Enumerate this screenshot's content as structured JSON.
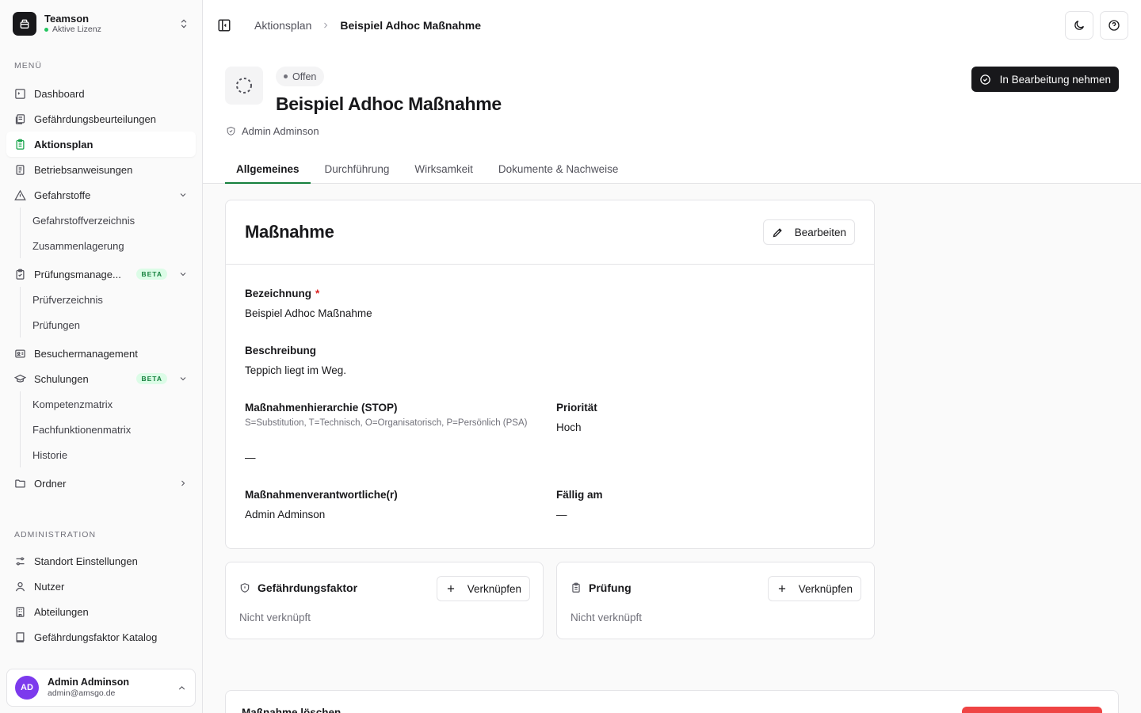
{
  "team": {
    "name": "Teamson",
    "status": "Aktive Lizenz"
  },
  "sidebar": {
    "menu_label": "MENÜ",
    "items": {
      "dashboard": "Dashboard",
      "gefaehrdungsbeurteilungen": "Gefährdungsbeurteilungen",
      "aktionsplan": "Aktionsplan",
      "betriebsanweisungen": "Betriebsanweisungen",
      "gefahrstoffe": "Gefahrstoffe",
      "gefahrstoffverzeichnis": "Gefahrstoffverzeichnis",
      "zusammenlagerung": "Zusammenlagerung",
      "pruefungsmanagement": "Prüfungsmanage...",
      "pruefungsmanagement_badge": "BETA",
      "pruefverzeichnis": "Prüfverzeichnis",
      "pruefungen": "Prüfungen",
      "besuchermanagement": "Besuchermanagement",
      "schulungen": "Schulungen",
      "schulungen_badge": "BETA",
      "kompetenzmatrix": "Kompetenzmatrix",
      "fachfunktionenmatrix": "Fachfunktionenmatrix",
      "historie": "Historie",
      "ordner": "Ordner"
    },
    "admin_label": "ADMINISTRATION",
    "admin_items": {
      "standort": "Standort Einstellungen",
      "nutzer": "Nutzer",
      "abteilungen": "Abteilungen",
      "katalog": "Gefährdungsfaktor Katalog"
    }
  },
  "user": {
    "initials": "AD",
    "name": "Admin Adminson",
    "email": "admin@amsgo.de"
  },
  "breadcrumb": {
    "parent": "Aktionsplan",
    "current": "Beispiel Adhoc Maßnahme"
  },
  "header": {
    "status": "Offen",
    "title": "Beispiel Adhoc Maßnahme",
    "owner": "Admin Adminson",
    "primary_action": "In Bearbeitung nehmen"
  },
  "tabs": [
    "Allgemeines",
    "Durchführung",
    "Wirksamkeit",
    "Dokumente & Nachweise"
  ],
  "measure": {
    "title": "Maßnahme",
    "edit_label": "Bearbeiten",
    "bezeichnung_label": "Bezeichnung",
    "required_mark": "*",
    "bezeichnung_value": "Beispiel Adhoc Maßnahme",
    "beschreibung_label": "Beschreibung",
    "beschreibung_value": "Teppich liegt im Weg.",
    "hierarchie_label": "Maßnahmenhierarchie (STOP)",
    "hierarchie_help": "S=Substitution, T=Technisch, O=Organisatorisch, P=Persönlich (PSA)",
    "hierarchie_value": "—",
    "prioritaet_label": "Priorität",
    "prioritaet_value": "Hoch",
    "verantwortlich_label": "Maßnahmenverantwortliche(r)",
    "verantwortlich_value": "Admin Adminson",
    "faellig_label": "Fällig am",
    "faellig_value": "—"
  },
  "links": {
    "faktor_title": "Gefährdungsfaktor",
    "faktor_action": "Verknüpfen",
    "faktor_empty": "Nicht verknüpft",
    "pruefung_title": "Prüfung",
    "pruefung_action": "Verknüpfen",
    "pruefung_empty": "Nicht verknüpft"
  },
  "danger": {
    "title": "Maßnahme löschen"
  },
  "colors": {
    "accent": "#15803d",
    "danger": "#ef4444",
    "avatar": "#7c3aed",
    "primary": "#18181b"
  }
}
